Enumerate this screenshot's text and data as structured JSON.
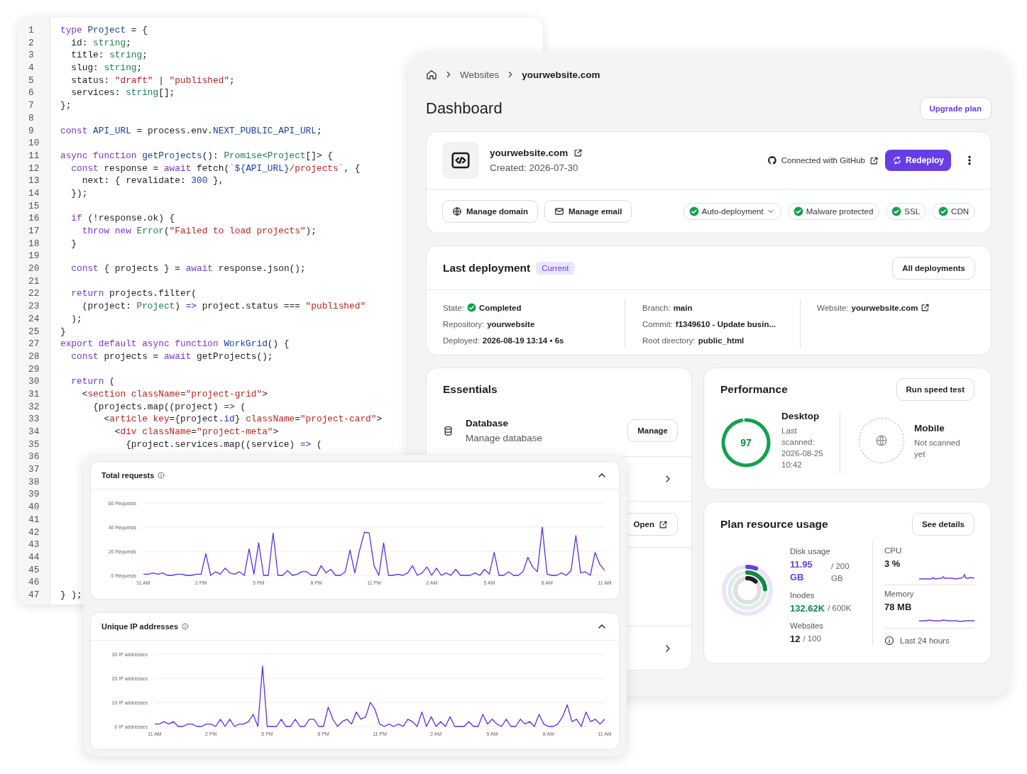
{
  "code_editor": {
    "lines": [
      {
        "number": "1",
        "tokens": [
          {
            "kind": "keyword",
            "text": "type"
          },
          {
            "kind": "name",
            "text": " Project"
          },
          {
            "kind": "plain",
            "text": " = {"
          }
        ]
      },
      {
        "number": "2",
        "tokens": [
          {
            "kind": "plain",
            "text": "  id: "
          },
          {
            "kind": "type",
            "text": "string"
          },
          {
            "kind": "plain",
            "text": ";"
          }
        ]
      },
      {
        "number": "3",
        "tokens": [
          {
            "kind": "plain",
            "text": "  title: "
          },
          {
            "kind": "type",
            "text": "string"
          },
          {
            "kind": "plain",
            "text": ";"
          }
        ]
      },
      {
        "number": "4",
        "tokens": [
          {
            "kind": "plain",
            "text": "  slug: "
          },
          {
            "kind": "type",
            "text": "string"
          },
          {
            "kind": "plain",
            "text": ";"
          }
        ]
      },
      {
        "number": "5",
        "tokens": [
          {
            "kind": "plain",
            "text": "  status: "
          },
          {
            "kind": "string",
            "text": "\"draft\""
          },
          {
            "kind": "plain",
            "text": " | "
          },
          {
            "kind": "string",
            "text": "\"published\""
          },
          {
            "kind": "plain",
            "text": ";"
          }
        ]
      },
      {
        "number": "6",
        "tokens": [
          {
            "kind": "plain",
            "text": "  services: "
          },
          {
            "kind": "type",
            "text": "string"
          },
          {
            "kind": "plain",
            "text": "[];"
          }
        ]
      },
      {
        "number": "7",
        "tokens": [
          {
            "kind": "plain",
            "text": "};"
          }
        ]
      },
      {
        "number": "8"
      },
      {
        "number": "9",
        "tokens": [
          {
            "kind": "keyword",
            "text": "const"
          },
          {
            "kind": "name",
            "text": " API_URL"
          },
          {
            "kind": "plain",
            "text": " = process.env."
          },
          {
            "kind": "name",
            "text": "NEXT_PUBLIC_API_URL"
          },
          {
            "kind": "plain",
            "text": ";"
          }
        ]
      },
      {
        "number": "10"
      },
      {
        "number": "11",
        "tokens": [
          {
            "kind": "keyword",
            "text": "async function"
          },
          {
            "kind": "name",
            "text": " getProjects"
          },
          {
            "kind": "plain",
            "text": "(): "
          },
          {
            "kind": "type",
            "text": "Promise<Project"
          },
          {
            "kind": "plain",
            "text": "[]> {"
          }
        ]
      },
      {
        "number": "12",
        "tokens": [
          {
            "kind": "keyword",
            "text": "  const"
          },
          {
            "kind": "plain",
            "text": " response = "
          },
          {
            "kind": "keyword",
            "text": "await"
          },
          {
            "kind": "plain",
            "text": " fetch("
          },
          {
            "kind": "string",
            "text": "`"
          },
          {
            "kind": "name",
            "text": "${API_URL}"
          },
          {
            "kind": "string",
            "text": "/projects`"
          },
          {
            "kind": "plain",
            "text": ", {"
          }
        ]
      },
      {
        "number": "13",
        "tokens": [
          {
            "kind": "plain",
            "text": "    next: { revalidate: "
          },
          {
            "kind": "name",
            "text": "300"
          },
          {
            "kind": "plain",
            "text": " },"
          }
        ]
      },
      {
        "number": "14",
        "tokens": [
          {
            "kind": "plain",
            "text": "  });"
          }
        ]
      },
      {
        "number": "15"
      },
      {
        "number": "16",
        "tokens": [
          {
            "kind": "keyword",
            "text": "  if"
          },
          {
            "kind": "plain",
            "text": " (!response.ok) {"
          }
        ]
      },
      {
        "number": "17",
        "tokens": [
          {
            "kind": "keyword",
            "text": "    throw new"
          },
          {
            "kind": "type",
            "text": " Error"
          },
          {
            "kind": "plain",
            "text": "("
          },
          {
            "kind": "string",
            "text": "\"Failed to load projects\""
          },
          {
            "kind": "plain",
            "text": ");"
          }
        ]
      },
      {
        "number": "18",
        "tokens": [
          {
            "kind": "plain",
            "text": "  }"
          }
        ]
      },
      {
        "number": "19"
      },
      {
        "number": "20",
        "tokens": [
          {
            "kind": "keyword",
            "text": "  const"
          },
          {
            "kind": "plain",
            "text": " { projects } = "
          },
          {
            "kind": "keyword",
            "text": "await"
          },
          {
            "kind": "plain",
            "text": " response.json();"
          }
        ]
      },
      {
        "number": "21"
      },
      {
        "number": "22",
        "tokens": [
          {
            "kind": "keyword",
            "text": "  return"
          },
          {
            "kind": "plain",
            "text": " projects.filter("
          }
        ]
      },
      {
        "number": "23",
        "tokens": [
          {
            "kind": "plain",
            "text": "    (project: "
          },
          {
            "kind": "type",
            "text": "Project"
          },
          {
            "kind": "plain",
            "text": ") "
          },
          {
            "kind": "name",
            "text": "=>"
          },
          {
            "kind": "plain",
            "text": " project.status === "
          },
          {
            "kind": "string",
            "text": "\"published\""
          }
        ]
      },
      {
        "number": "24",
        "tokens": [
          {
            "kind": "plain",
            "text": "  );"
          }
        ]
      },
      {
        "number": "25",
        "tokens": [
          {
            "kind": "plain",
            "text": "}"
          }
        ]
      },
      {
        "number": "27",
        "tokens": [
          {
            "kind": "keyword",
            "text": "export default async function"
          },
          {
            "kind": "name",
            "text": " WorkGrid"
          },
          {
            "kind": "plain",
            "text": "() {"
          }
        ]
      },
      {
        "number": "28",
        "tokens": [
          {
            "kind": "keyword",
            "text": "  const"
          },
          {
            "kind": "plain",
            "text": " projects = "
          },
          {
            "kind": "keyword",
            "text": "await"
          },
          {
            "kind": "plain",
            "text": " getProjects();"
          }
        ]
      },
      {
        "number": "29"
      },
      {
        "number": "30",
        "tokens": [
          {
            "kind": "keyword",
            "text": "  return"
          },
          {
            "kind": "plain",
            "text": " ("
          }
        ]
      },
      {
        "number": "31",
        "tokens": [
          {
            "kind": "plain",
            "text": "    <"
          },
          {
            "kind": "string",
            "text": "section className"
          },
          {
            "kind": "plain",
            "text": "="
          },
          {
            "kind": "string",
            "text": "\"project-grid\""
          },
          {
            "kind": "plain",
            "text": ">"
          }
        ]
      },
      {
        "number": "32",
        "tokens": [
          {
            "kind": "plain",
            "text": "      {projects.map((project) "
          },
          {
            "kind": "name",
            "text": "=>"
          },
          {
            "kind": "plain",
            "text": " ("
          }
        ]
      },
      {
        "number": "33",
        "tokens": [
          {
            "kind": "plain",
            "text": "        <"
          },
          {
            "kind": "string",
            "text": "article key"
          },
          {
            "kind": "plain",
            "text": "={project."
          },
          {
            "kind": "name",
            "text": "id"
          },
          {
            "kind": "plain",
            "text": "}"
          },
          {
            "kind": "string",
            "text": " className"
          },
          {
            "kind": "plain",
            "text": "="
          },
          {
            "kind": "string",
            "text": "\"project-card\""
          },
          {
            "kind": "plain",
            "text": ">"
          }
        ]
      },
      {
        "number": "34",
        "tokens": [
          {
            "kind": "plain",
            "text": "          <"
          },
          {
            "kind": "string",
            "text": "div className"
          },
          {
            "kind": "plain",
            "text": "="
          },
          {
            "kind": "string",
            "text": "\"project-meta\""
          },
          {
            "kind": "plain",
            "text": ">"
          }
        ]
      },
      {
        "number": "35",
        "tokens": [
          {
            "kind": "plain",
            "text": "            {project.services.map((service) "
          },
          {
            "kind": "name",
            "text": "=>"
          },
          {
            "kind": "plain",
            "text": " ("
          }
        ]
      },
      {
        "number": "36"
      },
      {
        "number": "37"
      },
      {
        "number": "38"
      },
      {
        "number": "39"
      },
      {
        "number": "40"
      },
      {
        "number": "41"
      },
      {
        "number": "42"
      },
      {
        "number": "43"
      },
      {
        "number": "44"
      },
      {
        "number": "45"
      },
      {
        "number": "46"
      },
      {
        "number": "47",
        "tokens": [
          {
            "kind": "plain",
            "text": "} );"
          }
        ]
      }
    ]
  },
  "dashboard": {
    "breadcrumb": [
      {
        "label": "Websites",
        "current": false
      },
      {
        "label": "yourwebsite.com",
        "current": true
      }
    ],
    "page_title": "Dashboard",
    "upgrade_button": "Upgrade plan",
    "site": {
      "name": "yourwebsite.com",
      "created": "Created: 2026-07-30",
      "git_status": "Connected with GitHub",
      "redeploy_button": "Redeploy",
      "actions": [
        "Manage domain",
        "Manage email"
      ],
      "features": [
        {
          "label": "Auto-deployment",
          "enabled": true,
          "dropdown": true
        },
        {
          "label": "Malware protected",
          "enabled": true,
          "dropdown": false
        },
        {
          "label": "SSL",
          "enabled": true,
          "dropdown": false
        },
        {
          "label": "CDN",
          "enabled": true,
          "dropdown": false
        }
      ]
    },
    "deployment": {
      "title": "Last deployment",
      "badge": "Current",
      "button": "All deployments",
      "columns": [
        [
          {
            "label": "State:",
            "value": "Completed",
            "kind": "status"
          },
          {
            "label": "Repository:",
            "value": "yourwebsite",
            "kind": "text"
          },
          {
            "label": "Deployed:",
            "value": "2026-08-19 13:14 • 6s",
            "kind": "text"
          }
        ],
        [
          {
            "label": "Branch:",
            "value": "main",
            "kind": "text"
          },
          {
            "label": "Commit:",
            "value": "f1349610 - Update busin...",
            "kind": "text"
          },
          {
            "label": "Root directory:",
            "value": "public_html",
            "kind": "text"
          }
        ],
        [
          {
            "label": "Website:",
            "value": "yourwebsite.com",
            "kind": "link"
          }
        ]
      ]
    },
    "essentials": {
      "title": "Essentials",
      "items": [
        {
          "kind": "service",
          "title": "Database",
          "subtitle": "Manage database",
          "action": "Manage"
        },
        {
          "kind": "link"
        },
        {
          "kind": "external",
          "action": "Open"
        },
        {
          "kind": "covered"
        },
        {
          "kind": "link"
        }
      ]
    },
    "performance": {
      "title": "Performance",
      "button": "Run speed test",
      "devices": [
        {
          "label": "Desktop",
          "note": "Last scanned: 2026-08-25 10:42",
          "scanned": true,
          "score": "97",
          "level": 0.97
        },
        {
          "label": "Mobile",
          "note": "Not scanned yet",
          "scanned": false
        }
      ]
    },
    "resources": {
      "title": "Plan resource usage",
      "button": "See details",
      "items": [
        {
          "label": "Disk usage",
          "value": "11.95 GB",
          "total": "/ 200 GB",
          "color": "#673de6"
        },
        {
          "label": "Inodes",
          "value": "132.62K",
          "total": "/ 600K",
          "color": "#0e8a45"
        },
        {
          "label": "Websites",
          "value": "12",
          "total": "/ 100",
          "color": "#1d1e20"
        }
      ],
      "metrics": [
        {
          "label": "CPU",
          "value": "3 %"
        },
        {
          "label": "Memory",
          "value": "78 MB"
        }
      ],
      "footnote": "Last 24 hours"
    }
  },
  "analytics": {
    "cards": [
      {
        "title": "Total requests",
        "expanded": true,
        "chart_data": {
          "type": "line",
          "ylim": [
            0,
            60
          ],
          "categories": [
            "11 AM",
            null,
            null,
            null,
            null,
            null,
            null,
            null,
            null,
            null,
            null,
            null,
            "2 PM",
            null,
            null,
            null,
            null,
            null,
            null,
            null,
            null,
            null,
            null,
            null,
            "5 PM",
            null,
            null,
            null,
            null,
            null,
            null,
            null,
            null,
            null,
            null,
            null,
            "8 PM",
            null,
            null,
            null,
            null,
            null,
            null,
            null,
            null,
            null,
            null,
            null,
            "11 PM",
            null,
            null,
            null,
            null,
            null,
            null,
            null,
            null,
            null,
            null,
            null,
            "2 AM",
            null,
            null,
            null,
            null,
            null,
            null,
            null,
            null,
            null,
            null,
            null,
            "5 AM",
            null,
            null,
            null,
            null,
            null,
            null,
            null,
            null,
            null,
            null,
            null,
            "8 AM",
            null,
            null,
            null,
            null,
            null,
            null,
            null,
            null,
            null,
            null,
            null,
            "11 AM"
          ],
          "yticks": [
            {
              "value": 0,
              "label": "0 Requests"
            },
            {
              "value": 20,
              "label": "20 Requests"
            },
            {
              "value": 40,
              "label": "40 Requests"
            },
            {
              "value": 60,
              "label": "60 Requests"
            }
          ],
          "series": [
            {
              "color": "#5b2ee8",
              "values": [
                1,
                1,
                2,
                1,
                2,
                0,
                0,
                1,
                1,
                0,
                0,
                1,
                1,
                18,
                0,
                3,
                1,
                6,
                2,
                1,
                3,
                0,
                22,
                1,
                27,
                0,
                0,
                35,
                0,
                0,
                4,
                0,
                1,
                3,
                3,
                0,
                0,
                8,
                2,
                5,
                0,
                0,
                3,
                21,
                2,
                21,
                36,
                35,
                8,
                0,
                27,
                0,
                0,
                1,
                0,
                2,
                8,
                0,
                2,
                7,
                0,
                6,
                0,
                2,
                0,
                5,
                0,
                0,
                0,
                2,
                0,
                5,
                1,
                19,
                0,
                0,
                3,
                0,
                0,
                3,
                15,
                7,
                3,
                40,
                1,
                0,
                0,
                2,
                0,
                4,
                33,
                2,
                3,
                0,
                19,
                9,
                4
              ]
            }
          ]
        }
      },
      {
        "title": "Unique IP addresses",
        "expanded": true,
        "chart_data": {
          "type": "line",
          "ylim": [
            0,
            30
          ],
          "categories": [
            "11 AM",
            null,
            null,
            null,
            null,
            null,
            null,
            null,
            null,
            null,
            null,
            null,
            "2 PM",
            null,
            null,
            null,
            null,
            null,
            null,
            null,
            null,
            null,
            null,
            null,
            "5 PM",
            null,
            null,
            null,
            null,
            null,
            null,
            null,
            null,
            null,
            null,
            null,
            "8 PM",
            null,
            null,
            null,
            null,
            null,
            null,
            null,
            null,
            null,
            null,
            null,
            "11 PM",
            null,
            null,
            null,
            null,
            null,
            null,
            null,
            null,
            null,
            null,
            null,
            "2 AM",
            null,
            null,
            null,
            null,
            null,
            null,
            null,
            null,
            null,
            null,
            null,
            "5 AM",
            null,
            null,
            null,
            null,
            null,
            null,
            null,
            null,
            null,
            null,
            null,
            "8 AM",
            null,
            null,
            null,
            null,
            null,
            null,
            null,
            null,
            null,
            null,
            null,
            "11 AM"
          ],
          "yticks": [
            {
              "value": 0,
              "label": "0 IP addresses"
            },
            {
              "value": 10,
              "label": "10 IP addresses"
            },
            {
              "value": 20,
              "label": "20 IP addresses"
            },
            {
              "value": 30,
              "label": "30 IP addresses"
            }
          ],
          "series": [
            {
              "color": "#5b2ee8",
              "values": [
                1,
                1,
                2,
                1,
                2,
                0,
                0,
                1,
                1,
                0,
                0,
                1,
                1,
                0,
                3,
                0,
                3,
                0,
                1,
                1,
                2,
                5,
                0,
                25,
                0,
                0,
                0,
                3,
                0,
                0,
                3,
                0,
                0,
                3,
                3,
                0,
                0,
                8,
                3,
                0,
                2,
                3,
                1,
                6,
                3,
                4,
                10,
                7,
                1,
                0,
                1,
                0,
                1,
                0,
                3,
                2,
                0,
                6,
                0,
                4,
                0,
                2,
                0,
                4,
                0,
                0,
                0,
                2,
                0,
                0,
                5,
                1,
                3,
                1,
                0,
                3,
                0,
                0,
                3,
                1,
                2,
                0,
                5,
                1,
                0,
                0,
                1,
                4,
                9,
                2,
                3,
                0,
                6,
                2,
                3,
                1,
                3
              ]
            }
          ]
        }
      }
    ]
  }
}
